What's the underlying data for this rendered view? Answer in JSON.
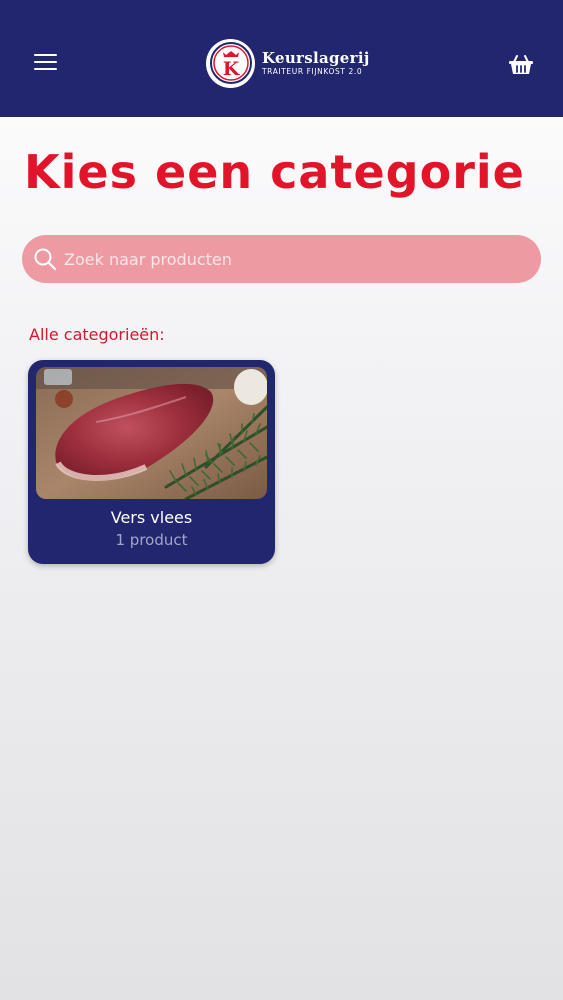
{
  "header": {
    "brand_name": "Keurslagerij",
    "brand_tagline": "TRAITEUR FIJNKOST 2.0",
    "logo_letter": "K",
    "menu_icon": "hamburger-menu-icon",
    "basket_icon": "basket-icon",
    "background_color": "#22266e"
  },
  "page": {
    "title": "Kies een categorie",
    "accent_color": "#e1142a"
  },
  "search": {
    "placeholder": "Zoek naar producten",
    "value": "",
    "icon": "search-icon"
  },
  "categories": {
    "label": "Alle categorieën:",
    "items": [
      {
        "name": "Vers vlees",
        "count": "1 product",
        "image": "raw-steak-with-rosemary-photo"
      }
    ]
  }
}
